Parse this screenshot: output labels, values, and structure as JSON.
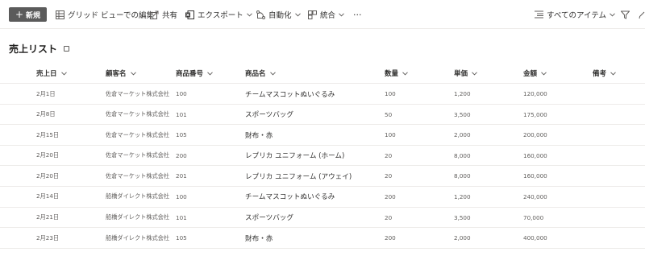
{
  "toolbar": {
    "new_label": "新規",
    "grid_edit_label": "グリッド ビューでの編集",
    "share_label": "共有",
    "export_label": "エクスポート",
    "automate_label": "自動化",
    "integrate_label": "統合",
    "more_label": "···",
    "view_label": "すべてのアイテム"
  },
  "list": {
    "title": "売上リスト"
  },
  "table": {
    "headers": [
      "売上日",
      "顧客名",
      "商品番号",
      "商品名",
      "数量",
      "単価",
      "金額",
      "備考"
    ],
    "rows": [
      [
        "2月1日",
        "佐倉マーケット株式会社",
        "100",
        "チームマスコットぬいぐるみ",
        "100",
        "1,200",
        "120,000",
        ""
      ],
      [
        "2月8日",
        "佐倉マーケット株式会社",
        "101",
        "スポーツバッグ",
        "50",
        "3,500",
        "175,000",
        ""
      ],
      [
        "2月15日",
        "佐倉マーケット株式会社",
        "105",
        "財布・赤",
        "100",
        "2,000",
        "200,000",
        ""
      ],
      [
        "2月20日",
        "佐倉マーケット株式会社",
        "200",
        "レプリカ ユニフォーム (ホーム)",
        "20",
        "8,000",
        "160,000",
        ""
      ],
      [
        "2月20日",
        "佐倉マーケット株式会社",
        "201",
        "レプリカ ユニフォーム (アウェイ)",
        "20",
        "8,000",
        "160,000",
        ""
      ],
      [
        "2月14日",
        "船橋ダイレクト株式会社",
        "100",
        "チームマスコットぬいぐるみ",
        "200",
        "1,200",
        "240,000",
        ""
      ],
      [
        "2月21日",
        "船橋ダイレクト株式会社",
        "101",
        "スポーツバッグ",
        "20",
        "3,500",
        "70,000",
        ""
      ],
      [
        "2月23日",
        "船橋ダイレクト株式会社",
        "105",
        "財布・赤",
        "200",
        "2,000",
        "400,000",
        ""
      ]
    ]
  },
  "icons": {
    "new": "plus-icon",
    "grid_edit": "grid-icon",
    "share": "share-icon",
    "export": "excel-icon",
    "automate": "flow-icon",
    "integrate": "integrate-icon",
    "view": "view-lines-icon",
    "filter": "filter-icon",
    "edit": "pencil-icon"
  }
}
